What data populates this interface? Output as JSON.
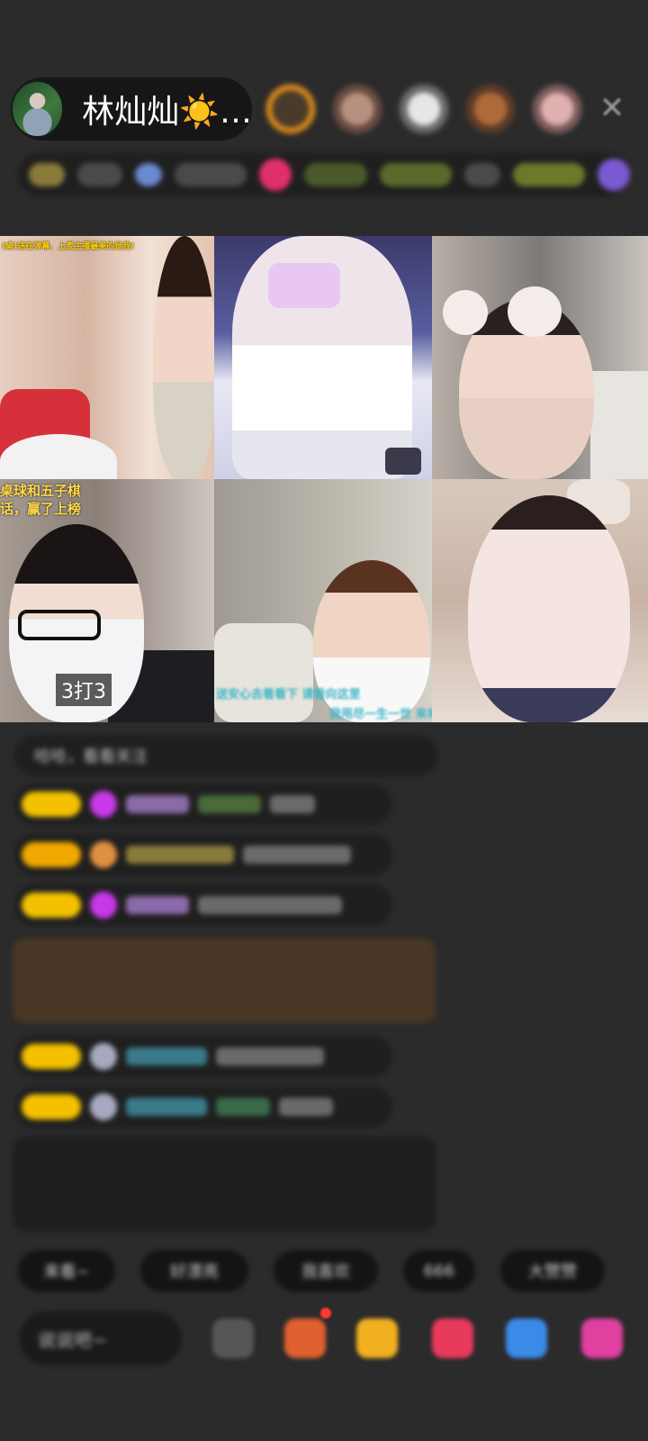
{
  "header": {
    "host_name": "林灿灿☀️…",
    "close_icon": "close-icon",
    "viewer_count": 5
  },
  "video_grid": {
    "tiles": [
      {
        "overlay": "(桌)送在弹幕、上麦主播最美的是我!"
      },
      {
        "overlay": ""
      },
      {
        "overlay": ""
      },
      {
        "overlay_line1": "桌球和五子棋",
        "overlay_line2": "话，赢了上榜",
        "label": "3打3"
      },
      {
        "caption_line1": "送安心去看看下  请看向这里",
        "caption_line2": "我用尽一生一世  来将你"
      },
      {
        "overlay": ""
      }
    ]
  },
  "chat": {
    "first_message": "哈哈，看看关注"
  },
  "bottom": {
    "input_placeholder": "说说吧~",
    "quick_replies": [
      "来看~",
      "好漂亮",
      "我喜欢",
      "666",
      "大赞赞"
    ]
  }
}
